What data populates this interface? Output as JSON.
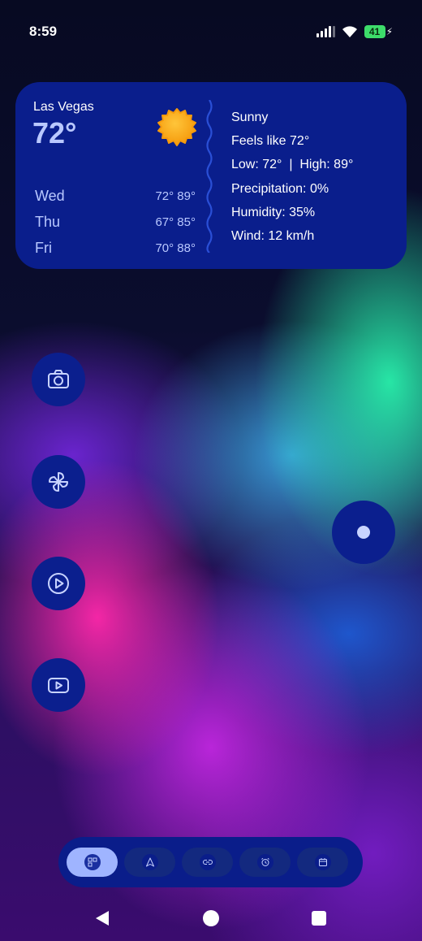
{
  "status_bar": {
    "time": "8:59",
    "battery_level": "41",
    "icons": [
      "signal-icon",
      "wifi-icon",
      "battery-charging-icon"
    ]
  },
  "weather": {
    "city": "Las Vegas",
    "current_temp": "72°",
    "icon": "sun-icon",
    "forecast": [
      {
        "day": "Wed",
        "range": "72° 89°"
      },
      {
        "day": "Thu",
        "range": "67° 85°"
      },
      {
        "day": "Fri",
        "range": "70° 88°"
      }
    ],
    "details": {
      "condition": "Sunny",
      "feels_like": "Feels like 72°",
      "low_high": "Low: 72°  |  High: 89°",
      "precipitation": "Precipitation: 0%",
      "humidity": "Humidity: 35%",
      "wind": "Wind: 12 km/h"
    }
  },
  "shortcuts": [
    {
      "icon": "camera-icon"
    },
    {
      "icon": "pinwheel-icon"
    },
    {
      "icon": "play-circle-icon"
    },
    {
      "icon": "youtube-icon"
    }
  ],
  "dock": {
    "items": [
      {
        "icon": "widgets-icon",
        "active": true
      },
      {
        "icon": "navigation-icon",
        "active": false
      },
      {
        "icon": "link-icon",
        "active": false
      },
      {
        "icon": "alarm-icon",
        "active": false
      },
      {
        "icon": "calendar-icon",
        "active": false
      }
    ]
  },
  "navbar": {
    "icons": [
      "back-icon",
      "home-icon",
      "recents-icon"
    ]
  },
  "colors": {
    "widget_bg": "#0a1e8c",
    "accent_text": "#b9c8ff",
    "battery": "#3ddc6a"
  }
}
